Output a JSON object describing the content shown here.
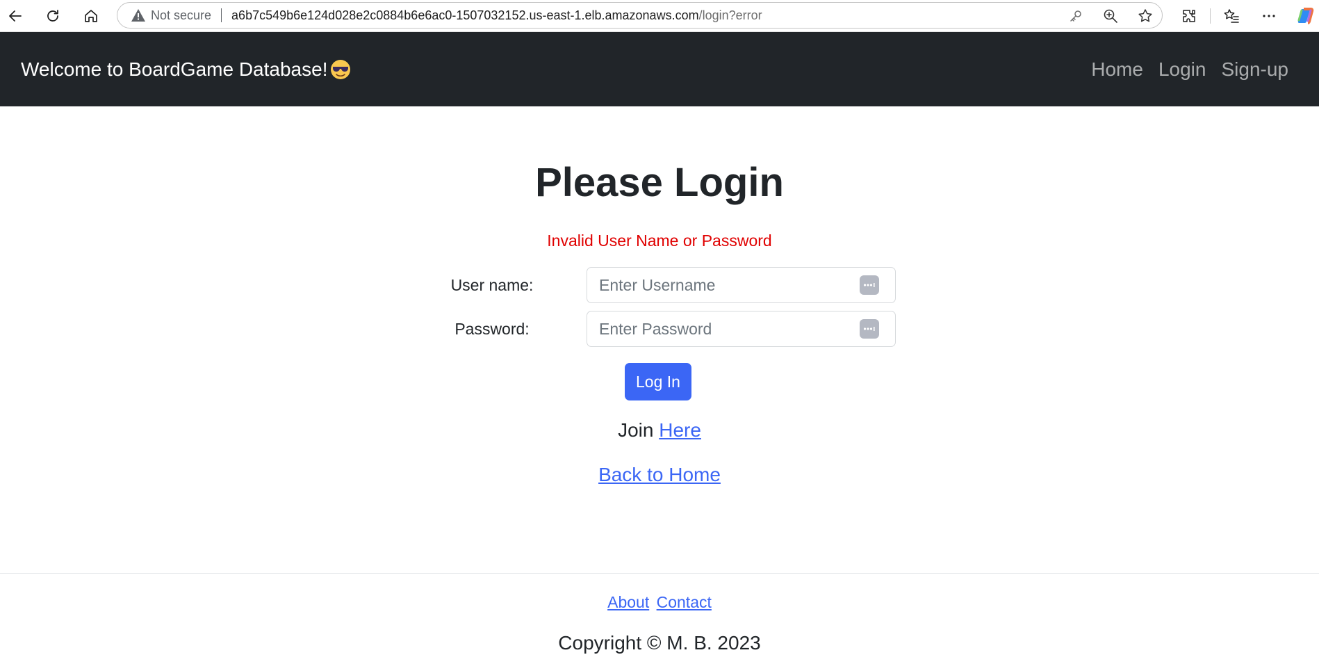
{
  "browser": {
    "security_label": "Not secure",
    "url_host": "a6b7c549b6e124d028e2c0884b6e6ac0-1507032152.us-east-1.elb.amazonaws.com",
    "url_path": "/login?error"
  },
  "navbar": {
    "brand": "Welcome to BoardGame Database!",
    "brand_emoji": "smiling-face-with-sunglasses",
    "links": [
      {
        "label": "Home"
      },
      {
        "label": "Login"
      },
      {
        "label": "Sign-up"
      }
    ]
  },
  "login": {
    "title": "Please Login",
    "error": "Invalid User Name or Password",
    "username_label": "User name:",
    "username_placeholder": "Enter Username",
    "password_label": "Password:",
    "password_placeholder": "Enter Password",
    "submit_label": "Log In",
    "join_prefix": "Join",
    "join_link": "Here",
    "back_home": "Back to Home"
  },
  "footer": {
    "about": "About",
    "contact": "Contact",
    "copyright": "Copyright © M. B. 2023"
  },
  "colors": {
    "navbar_bg": "#212529",
    "primary": "#3b66f5",
    "error": "#e00000"
  }
}
